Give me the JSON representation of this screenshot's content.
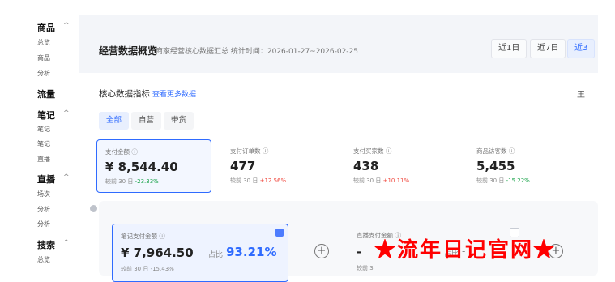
{
  "sidebar": {
    "items": [
      {
        "label": "商品",
        "bold": true,
        "chevron": "^"
      },
      {
        "label": "总览",
        "bold": false
      },
      {
        "label": "商品",
        "bold": false
      },
      {
        "label": "分析",
        "bold": false
      },
      {
        "label": "流量",
        "bold": true
      },
      {
        "label": "笔记",
        "bold": true,
        "chevron": "^"
      },
      {
        "label": "笔记",
        "bold": false
      },
      {
        "label": "笔记",
        "bold": false
      },
      {
        "label": "直播",
        "bold": false
      },
      {
        "label": "直播",
        "bold": true,
        "chevron": "^"
      },
      {
        "label": "场次",
        "bold": false
      },
      {
        "label": "分析",
        "bold": false
      },
      {
        "label": "分析",
        "bold": false
      },
      {
        "label": "搜索",
        "bold": true,
        "chevron": "^"
      },
      {
        "label": "总览",
        "bold": false
      }
    ]
  },
  "header": {
    "title": "经营数据概览",
    "subtitle": "商家经营核心数据汇总  统计时间：2026-01-27~2026-02-25",
    "ranges": [
      "近1日",
      "近7日",
      "近3"
    ]
  },
  "core": {
    "title": "核心数据指标",
    "link": "查看更多数据",
    "right_label": "王",
    "tabs": [
      "全部",
      "自营",
      "带货"
    ],
    "compare_prefix": "较前 30 日"
  },
  "metrics": [
    {
      "label": "支付金额 ⓘ",
      "value": "¥ 8,544.40",
      "change": "-23.33%",
      "dir": "down"
    },
    {
      "label": "支付订单数 ⓘ",
      "value": "477",
      "change": "+12.56%",
      "dir": "up"
    },
    {
      "label": "支付买家数 ⓘ",
      "value": "438",
      "change": "+10.11%",
      "dir": "up"
    },
    {
      "label": "商品访客数 ⓘ",
      "value": "5,455",
      "change": "-15.22%",
      "dir": "down"
    }
  ],
  "sub_metrics": {
    "note": {
      "label": "笔记支付金额 ⓘ",
      "value": "¥ 7,964.50",
      "share_label": "占比",
      "share_value": "93.21%",
      "change": "较前 30 日 -15.43%"
    },
    "live": {
      "label": "直播支付金额 ⓘ",
      "value": "-",
      "share_label": "占比",
      "share_value": "-",
      "change": "较前 3"
    }
  },
  "watermark": "★流年日记官网★",
  "colors": {
    "accent": "#2f6bff",
    "up": "#f0483e",
    "down": "#1aa34a"
  }
}
